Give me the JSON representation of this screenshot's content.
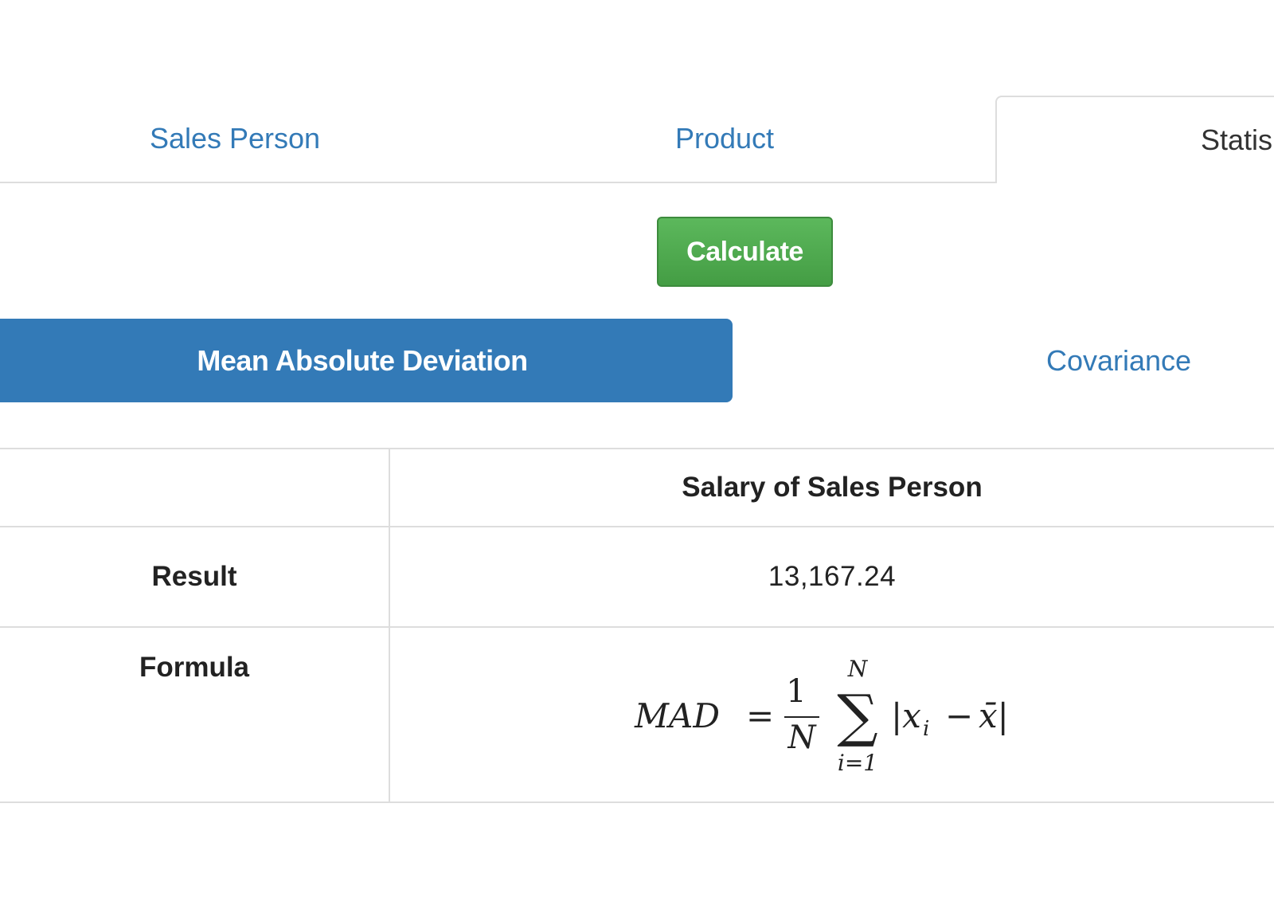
{
  "tabs": [
    {
      "label": "Sales Person"
    },
    {
      "label": "Product"
    },
    {
      "label": "Statis"
    }
  ],
  "calculate_label": "Calculate",
  "pills": [
    {
      "label": "Mean Absolute Deviation"
    },
    {
      "label": "Covariance"
    }
  ],
  "table": {
    "column_header": "Salary of Sales Person",
    "result_label": "Result",
    "result_value": "13,167.24",
    "formula_label": "Formula",
    "formula": {
      "lhs": "MAD",
      "equals": "=",
      "numerator": "1",
      "denominator": "N",
      "sum_upper": "N",
      "sum_lower": "i=1",
      "sum_symbol": "∑",
      "term": "|x",
      "term_sub": "i",
      "minus": "−",
      "xbar": "x̄|"
    }
  },
  "colors": {
    "link": "#337ab7",
    "active_pill": "#337ab7",
    "success": "#5cb85c",
    "border": "#dddddd"
  }
}
